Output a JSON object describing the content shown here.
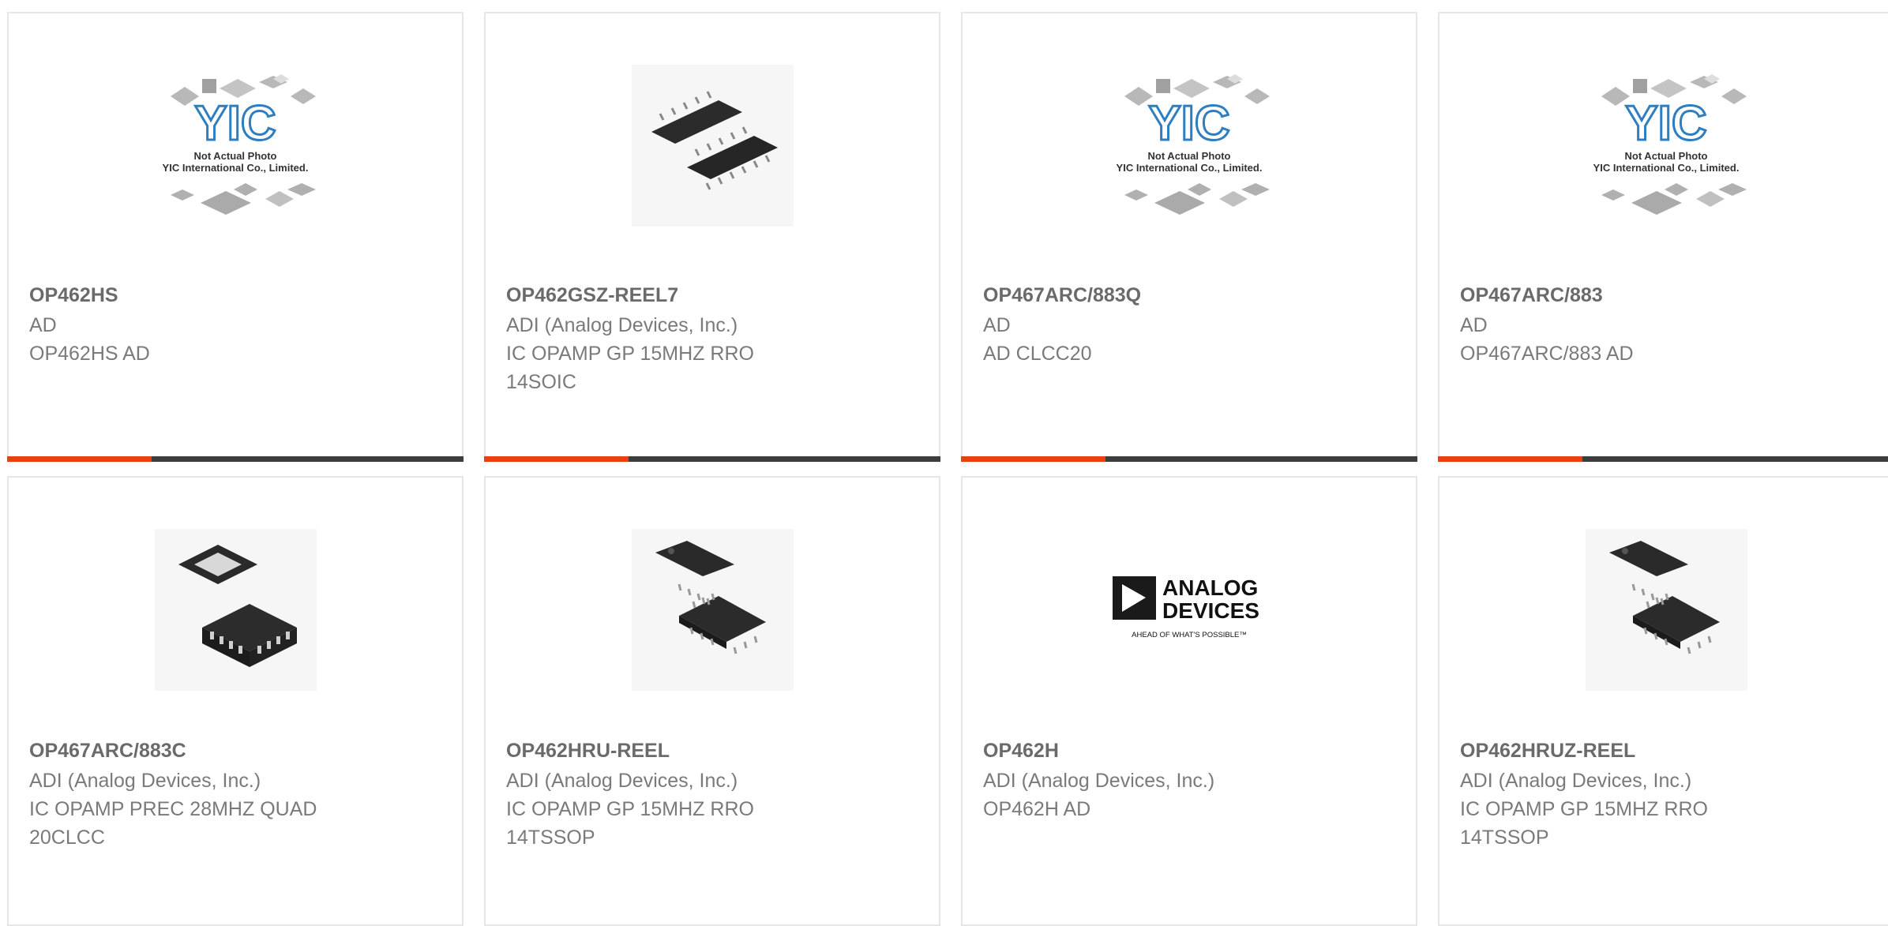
{
  "cards": [
    {
      "part": "OP462HS",
      "mfr": "AD",
      "desc": [
        "OP462HS AD"
      ],
      "image": "yic-placeholder",
      "placeholder": {
        "line1": "Not Actual Photo",
        "line2": "YIC International Co., Limited."
      }
    },
    {
      "part": "OP462GSZ-REEL7",
      "mfr": "ADI (Analog Devices, Inc.)",
      "desc": [
        "IC OPAMP GP 15MHZ RRO",
        "14SOIC"
      ],
      "image": "soic-chip-photo"
    },
    {
      "part": "OP467ARC/883Q",
      "mfr": "AD",
      "desc": [
        "AD CLCC20"
      ],
      "image": "yic-placeholder",
      "placeholder": {
        "line1": "Not Actual Photo",
        "line2": "YIC International Co., Limited."
      }
    },
    {
      "part": "OP467ARC/883",
      "mfr": "AD",
      "desc": [
        "OP467ARC/883 AD"
      ],
      "image": "yic-placeholder",
      "placeholder": {
        "line1": "Not Actual Photo",
        "line2": "YIC International Co., Limited."
      }
    },
    {
      "part": "OP467ARC/883C",
      "mfr": "ADI (Analog Devices, Inc.)",
      "desc": [
        "IC OPAMP PREC 28MHZ QUAD",
        "20CLCC"
      ],
      "image": "clcc-chip-photo"
    },
    {
      "part": "OP462HRU-REEL",
      "mfr": "ADI (Analog Devices, Inc.)",
      "desc": [
        "IC OPAMP GP 15MHZ RRO",
        "14TSSOP"
      ],
      "image": "tssop-chip-photo"
    },
    {
      "part": "OP462H",
      "mfr": "ADI (Analog Devices, Inc.)",
      "desc": [
        "OP462H AD"
      ],
      "image": "analog-devices-logo",
      "logo": {
        "line1": "ANALOG",
        "line2": "DEVICES",
        "tagline": "AHEAD OF WHAT'S POSSIBLE™"
      }
    },
    {
      "part": "OP462HRUZ-REEL",
      "mfr": "ADI (Analog Devices, Inc.)",
      "desc": [
        "IC OPAMP GP 15MHZ RRO",
        "14TSSOP"
      ],
      "image": "tssop-chip-photo"
    }
  ],
  "colors": {
    "accent": "#e8410f",
    "bar": "#3d3d3d",
    "border": "#e6e6e6",
    "title": "#6a6a6a",
    "text": "#7a7a7a"
  }
}
